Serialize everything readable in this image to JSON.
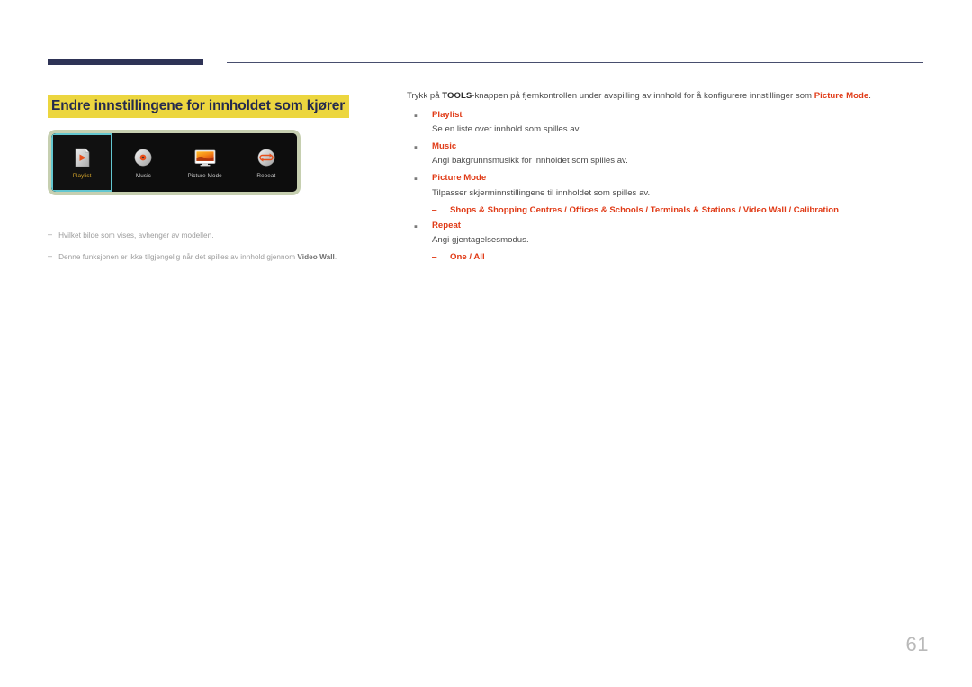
{
  "page": {
    "number": "61",
    "title": "Endre innstillingene for innholdet som kjører",
    "title_highlight_color": "#ecd63f",
    "title_text_color": "#242a4e",
    "rule_color": "#2e3356",
    "accent_color": "#e03a16"
  },
  "figure": {
    "name": "tools-toolbar",
    "items": [
      {
        "label": "Playlist",
        "icon": "playlist-file-icon",
        "selected": true
      },
      {
        "label": "Music",
        "icon": "music-disc-icon",
        "selected": false
      },
      {
        "label": "Picture Mode",
        "icon": "picture-mode-monitor-icon",
        "selected": false
      },
      {
        "label": "Repeat",
        "icon": "repeat-loop-icon",
        "selected": false
      }
    ]
  },
  "notes": [
    {
      "dash": "‒",
      "text": "Hvilket bilde som vises, avhenger av modellen.",
      "bold_tail": ""
    },
    {
      "dash": "‒",
      "text": "Denne funksjonen er ikke tilgjengelig når det spilles av innhold gjennom ",
      "bold_tail": "Video Wall",
      "tail_period": "."
    }
  ],
  "content": {
    "intro": {
      "part1": "Trykk på ",
      "bold1": "TOOLS",
      "part2": "-knappen på fjernkontrollen under avspilling av innhold for å konfigurere innstillinger som ",
      "accent1": "Picture Mode",
      "part3": "."
    },
    "bullets": [
      {
        "marker": "▪",
        "title": "Playlist",
        "description": "Se en liste over innhold som spilles av.",
        "options": []
      },
      {
        "marker": "▪",
        "title": "Music",
        "description": "Angi bakgrunnsmusikk for innholdet som spilles av.",
        "options": []
      },
      {
        "marker": "▪",
        "title": "Picture Mode",
        "description": "Tilpasser skjerminnstillingene til innholdet som spilles av.",
        "options": [
          {
            "dash": "‒",
            "text": "Shops & Shopping Centres / Offices & Schools / Terminals & Stations / Video Wall / Calibration"
          }
        ]
      },
      {
        "marker": "▪",
        "title": "Repeat",
        "description": "Angi gjentagelsesmodus.",
        "options": [
          {
            "dash": "‒",
            "text": "One / All"
          }
        ]
      }
    ]
  }
}
